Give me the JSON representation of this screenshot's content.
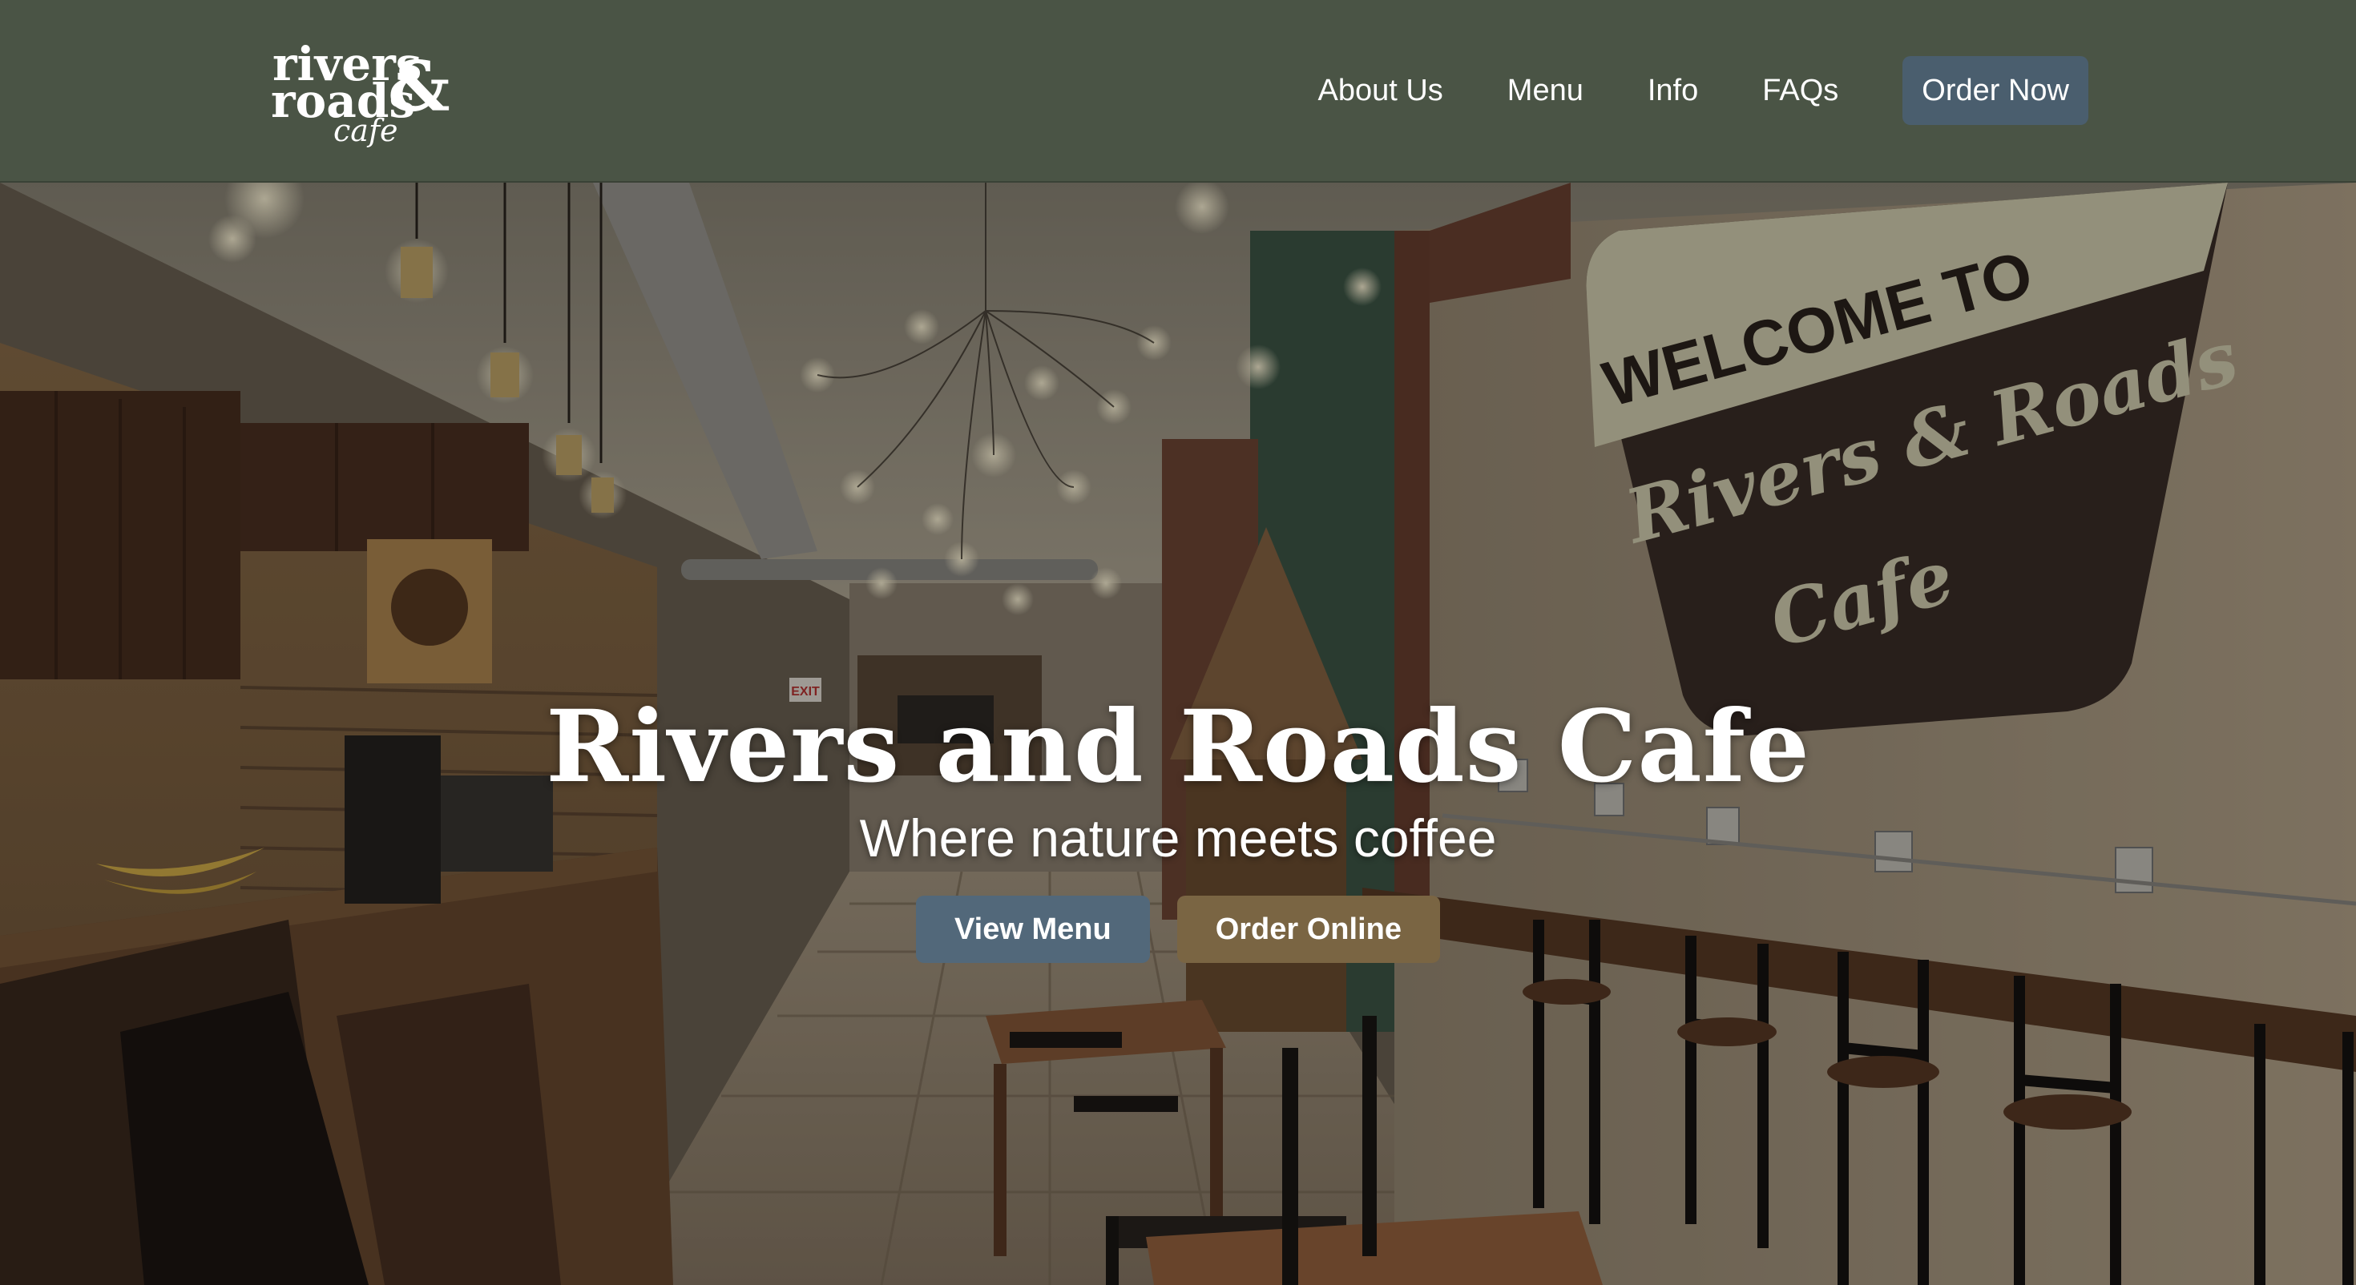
{
  "brand": {
    "logo_line1": "rivers",
    "logo_line2": "roads",
    "logo_amp": "&",
    "logo_script": "cafe"
  },
  "nav": {
    "links": [
      "About Us",
      "Menu",
      "Info",
      "FAQs"
    ],
    "cta": "Order Now"
  },
  "hero": {
    "title": "Rivers and Roads Cafe",
    "subtitle": "Where nature meets coffee",
    "primary_button": "View Menu",
    "secondary_button": "Order Online",
    "sign_line1": "WELCOME TO",
    "sign_line2": "Rivers & Roads",
    "sign_line3": "Cafe",
    "exit_sign": "EXIT"
  },
  "colors": {
    "nav_bg": "#4a5445",
    "order_now_bg": "#4a5e6e",
    "view_menu_bg": "#52687a",
    "order_online_bg": "#7a6543"
  }
}
